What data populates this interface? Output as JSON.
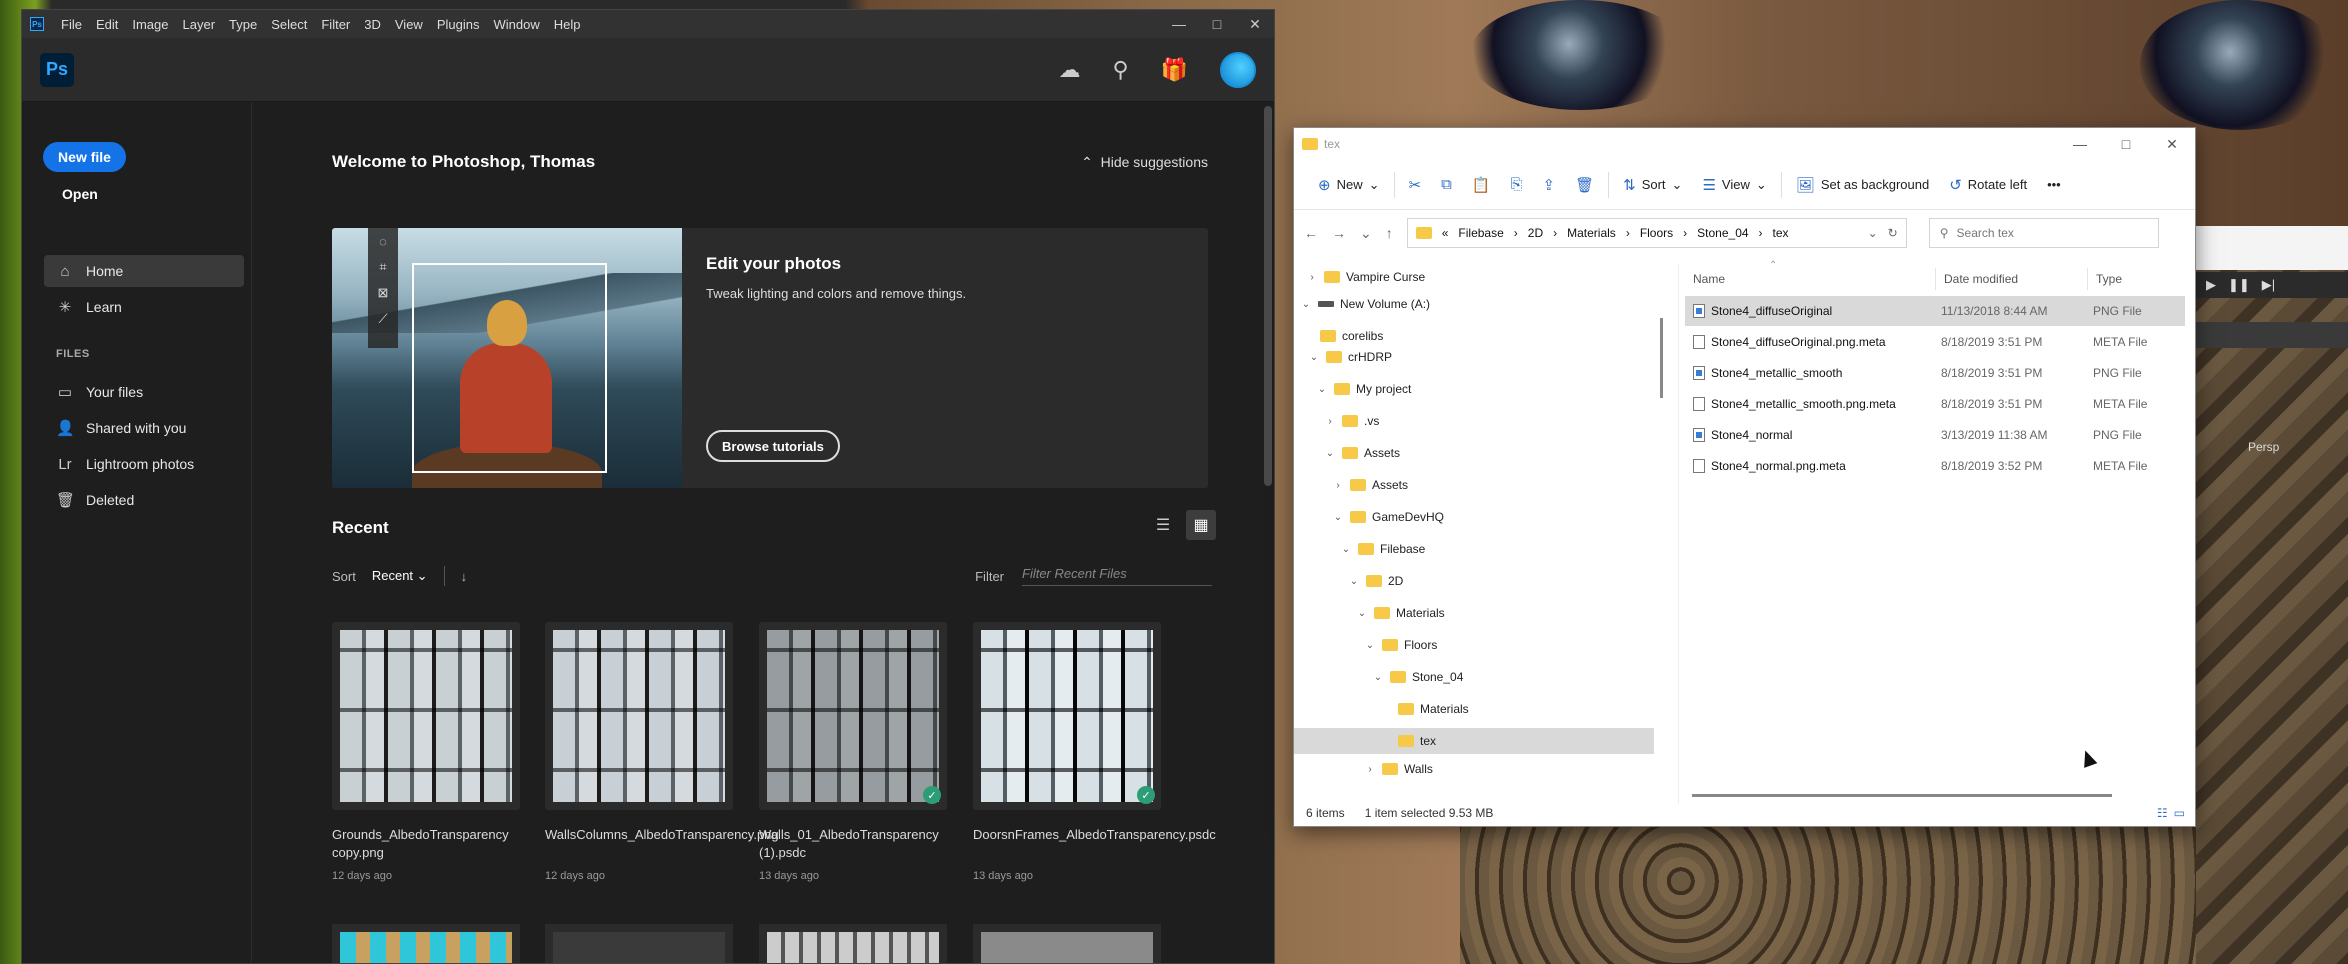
{
  "photoshop": {
    "menu": [
      "File",
      "Edit",
      "Image",
      "Layer",
      "Type",
      "Select",
      "Filter",
      "3D",
      "View",
      "Plugins",
      "Window",
      "Help"
    ],
    "logo": "Ps",
    "welcome": "Welcome to Photoshop, Thomas",
    "hide_suggestions": "Hide suggestions",
    "new_file": "New file",
    "open": "Open",
    "nav": {
      "home": "Home",
      "learn": "Learn"
    },
    "files_heading": "FILES",
    "files_nav": {
      "your_files": "Your files",
      "shared": "Shared with you",
      "lightroom": "Lightroom photos",
      "deleted": "Deleted"
    },
    "hero": {
      "title": "Edit your photos",
      "desc": "Tweak lighting and colors and remove things.",
      "button": "Browse tutorials"
    },
    "recent": "Recent",
    "sort_label": "Sort",
    "sort_value": "Recent",
    "filter_label": "Filter",
    "filter_placeholder": "Filter Recent Files",
    "files": [
      {
        "name": "Grounds_AlbedoTransparency copy.png",
        "date": "12 days ago",
        "synced": false
      },
      {
        "name": "WallsColumns_AlbedoTransparency.png",
        "date": "12 days ago",
        "synced": false
      },
      {
        "name": "Walls_01_AlbedoTransparency (1).psdc",
        "date": "13 days ago",
        "synced": true
      },
      {
        "name": "DoorsnFrames_AlbedoTransparency.psdc",
        "date": "13 days ago",
        "synced": true
      }
    ],
    "accent": "#1473e6"
  },
  "explorer": {
    "title": "tex",
    "cmd": {
      "new": "New",
      "sort": "Sort",
      "view": "View",
      "set_bg": "Set as background",
      "rotate": "Rotate left"
    },
    "breadcrumb": [
      "Filebase",
      "2D",
      "Materials",
      "Floors",
      "Stone_04",
      "tex"
    ],
    "search_placeholder": "Search tex",
    "tree": {
      "vampire": "Vampire Curse",
      "volume": "New Volume (A:)",
      "corelibs": "corelibs",
      "crhdrp": "crHDRP",
      "myproject": "My project",
      "vs": ".vs",
      "assets": "Assets",
      "assets2": "Assets",
      "gamedev": "GameDevHQ",
      "filebase": "Filebase",
      "d2": "2D",
      "materials": "Materials",
      "floors": "Floors",
      "stone": "Stone_04",
      "materials2": "Materials",
      "tex": "tex",
      "walls": "Walls"
    },
    "headers": {
      "name": "Name",
      "date": "Date modified",
      "type": "Type"
    },
    "files": [
      {
        "name": "Stone4_diffuseOriginal",
        "date": "11/13/2018 8:44 AM",
        "type": "PNG File"
      },
      {
        "name": "Stone4_diffuseOriginal.png.meta",
        "date": "8/18/2019 3:51 PM",
        "type": "META File"
      },
      {
        "name": "Stone4_metallic_smooth",
        "date": "8/18/2019 3:51 PM",
        "type": "PNG File"
      },
      {
        "name": "Stone4_metallic_smooth.png.meta",
        "date": "8/18/2019 3:51 PM",
        "type": "META File"
      },
      {
        "name": "Stone4_normal",
        "date": "3/13/2019 11:38 AM",
        "type": "PNG File"
      },
      {
        "name": "Stone4_normal.png.meta",
        "date": "8/18/2019 3:52 PM",
        "type": "META File"
      }
    ],
    "status_items": "6 items",
    "status_selected": "1 item selected  9.53 MB"
  },
  "unity": {
    "persp": "Persp"
  }
}
